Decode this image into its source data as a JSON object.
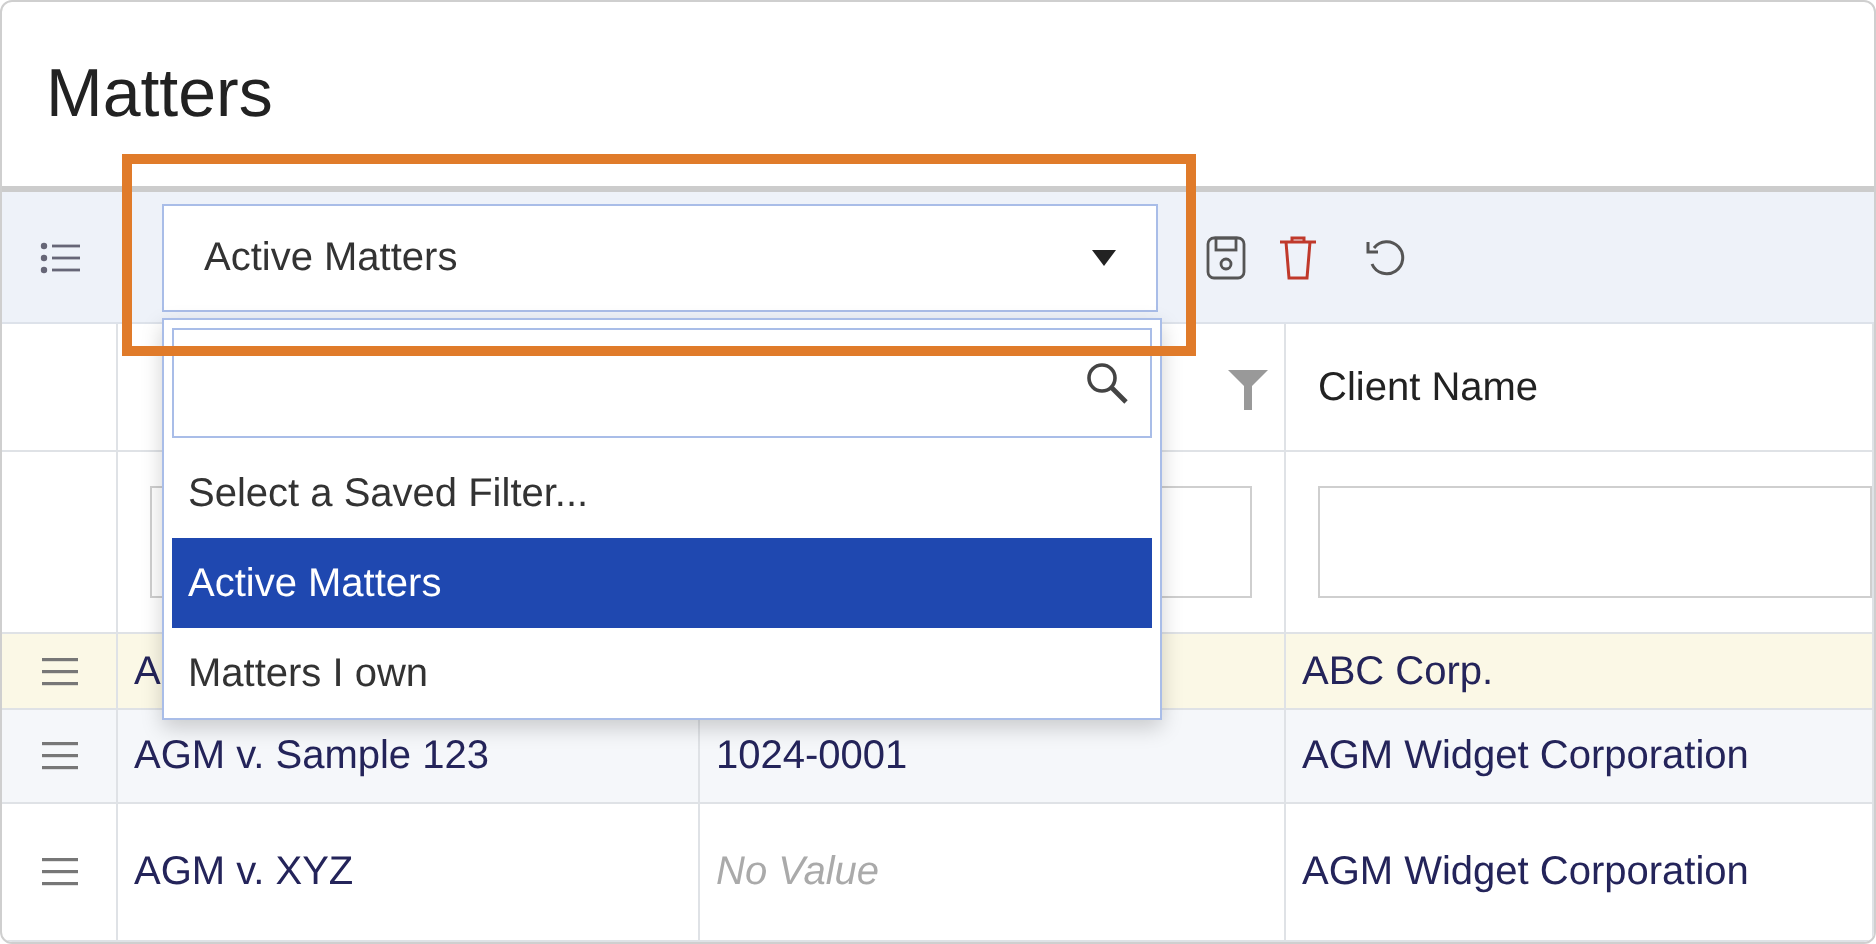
{
  "page": {
    "title": "Matters"
  },
  "toolbar": {
    "saved_filter": {
      "value": "Active Matters",
      "expanded": true
    }
  },
  "dropdown": {
    "options": [
      {
        "label": "Select a Saved Filter...",
        "selected": false
      },
      {
        "label": "Active Matters",
        "selected": true
      },
      {
        "label": "Matters I own",
        "selected": false
      }
    ]
  },
  "table": {
    "column_3": "Client Name",
    "rows": [
      {
        "highlighted": true,
        "column_1": "A",
        "column_3": "ABC Corp."
      },
      {
        "highlighted": false,
        "column_1": "AGM v. Sample 123",
        "column_2": "1024-0001",
        "column_2_empty": false,
        "column_3": "AGM Widget Corporation"
      },
      {
        "highlighted": false,
        "column_1": "AGM v. XYZ",
        "column_2": "No Value",
        "column_2_empty": true,
        "column_3": "AGM Widget Corporation"
      }
    ]
  }
}
